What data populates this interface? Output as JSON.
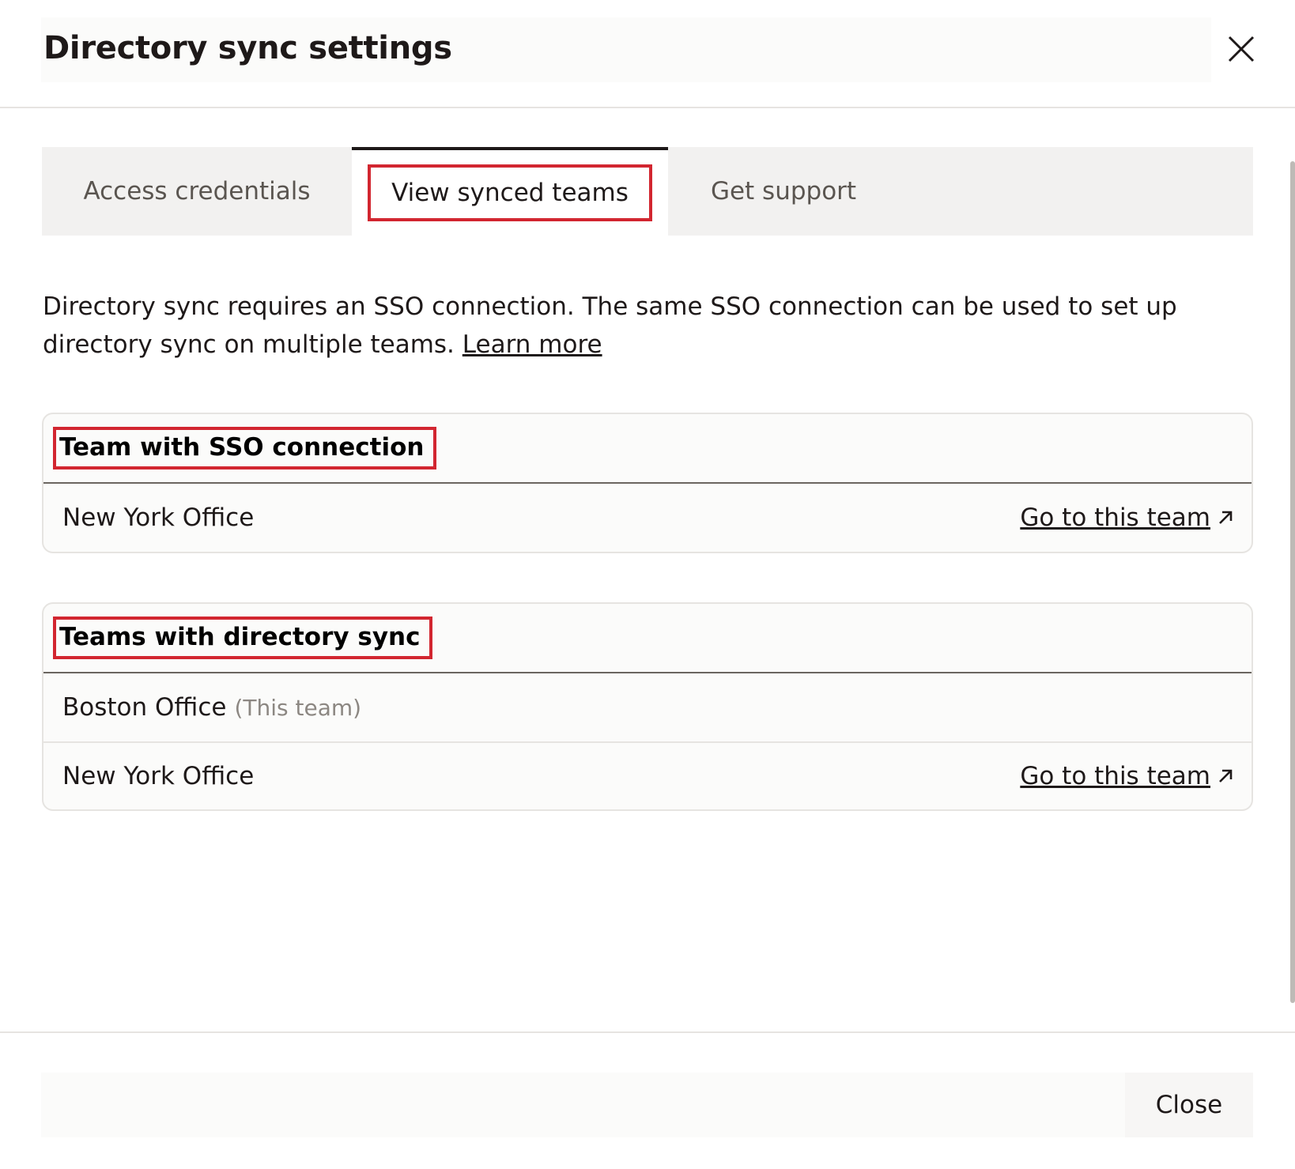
{
  "dialog": {
    "title": "Directory sync settings",
    "close_icon": "close-icon"
  },
  "tabs": [
    {
      "label": "Access credentials",
      "active": false
    },
    {
      "label": "View synced teams",
      "active": true
    },
    {
      "label": "Get support",
      "active": false
    }
  ],
  "description": {
    "text": "Directory sync requires an SSO connection. The same SSO connection can be used to set up directory sync on multiple teams. ",
    "link": "Learn more"
  },
  "sso_section": {
    "title": "Team with SSO connection",
    "rows": [
      {
        "name": "New York Office",
        "link": "Go to this team",
        "icon": "external-arrow-icon"
      }
    ]
  },
  "sync_section": {
    "title": "Teams with directory sync",
    "rows": [
      {
        "name": "Boston Office",
        "note": "(This team)"
      },
      {
        "name": "New York Office",
        "link": "Go to this team",
        "icon": "external-arrow-icon"
      }
    ]
  },
  "footer": {
    "close_label": "Close"
  },
  "colors": {
    "highlight": "#d22630",
    "text": "#1e1919",
    "tab_bg": "#f2f1f0"
  }
}
